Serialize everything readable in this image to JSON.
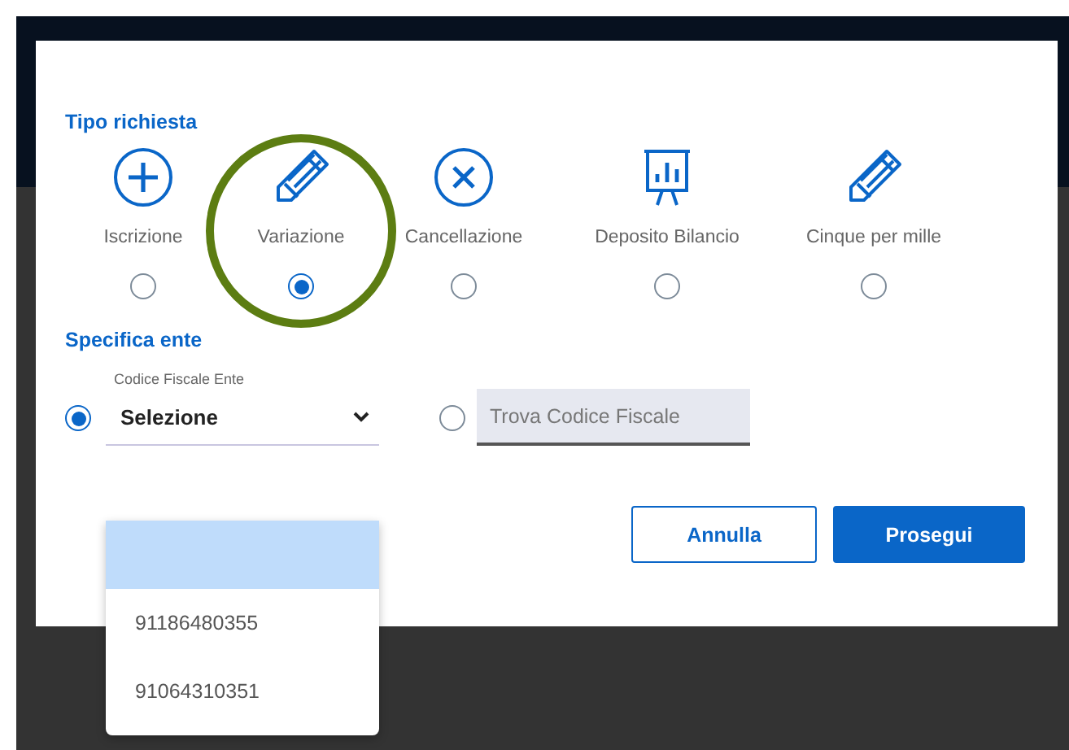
{
  "request_section": {
    "title": "Tipo richiesta",
    "types": [
      {
        "label": "Iscrizione",
        "kind": "plus",
        "selected": false,
        "highlighted": false
      },
      {
        "label": "Variazione",
        "kind": "pencil",
        "selected": true,
        "highlighted": true
      },
      {
        "label": "Cancellazione",
        "kind": "cross",
        "selected": false,
        "highlighted": false
      },
      {
        "label": "Deposito Bilancio",
        "kind": "chart",
        "selected": false,
        "highlighted": false
      },
      {
        "label": "Cinque per mille",
        "kind": "pencil",
        "selected": false,
        "highlighted": false
      }
    ]
  },
  "entity_section": {
    "title": "Specifica ente",
    "select": {
      "label": "Codice Fiscale Ente",
      "value": "Selezione",
      "selected": true,
      "options": [
        {
          "selected": true
        },
        {
          "label": "91186480355",
          "selected": false
        },
        {
          "label": "91064310351",
          "selected": false
        }
      ]
    },
    "search": {
      "placeholder": "Trova Codice Fiscale",
      "selected": false
    }
  },
  "buttons": [
    {
      "label": "Annulla",
      "kind": "secondary"
    },
    {
      "label": "Prosegui",
      "kind": "primary"
    }
  ]
}
